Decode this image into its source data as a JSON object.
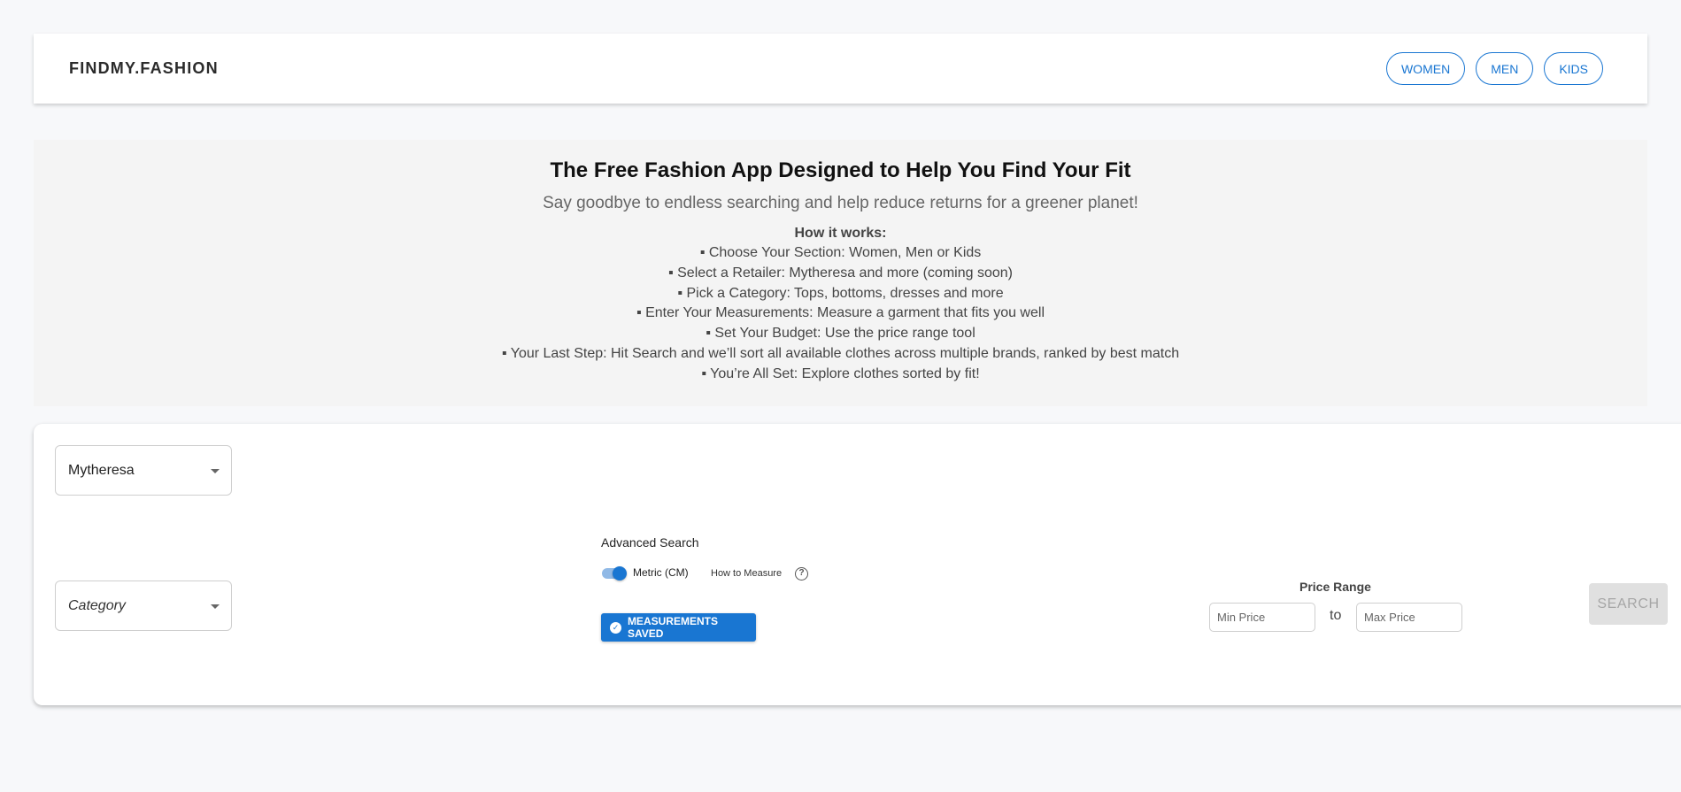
{
  "header": {
    "logo": "FINDMY.FASHION",
    "nav": [
      "WOMEN",
      "MEN",
      "KIDS"
    ]
  },
  "intro": {
    "title": "The Free Fashion App Designed to Help You Find Your Fit",
    "subtitle": "Say goodbye to endless searching and help reduce returns for a greener planet!",
    "how_title": "How it works:",
    "steps": [
      "▪ Choose Your Section: Women, Men or Kids",
      "▪ Select a Retailer: Mytheresa and more (coming soon)",
      "▪ Pick a Category: Tops, bottoms, dresses and more",
      "▪ Enter Your Measurements: Measure a garment that fits you well",
      "▪ Set Your Budget: Use the price range tool",
      "▪ Your Last Step: Hit Search and we’ll sort all available clothes across multiple brands, ranked by best match",
      "▪ You’re All Set: Explore clothes sorted by fit!"
    ]
  },
  "search": {
    "retailer": "Mytheresa",
    "category_placeholder": "Category",
    "advanced_title": "Advanced Search",
    "unit_label": "Metric (CM)",
    "unit_toggle_on": true,
    "how_to_measure": "How to Measure",
    "help_icon": "question-circle-icon",
    "saved_label": "MEASUREMENTS SAVED",
    "saved_icon": "check-circle-icon",
    "price_title": "Price Range",
    "min_placeholder": "Min Price",
    "to_label": "to",
    "max_placeholder": "Max Price",
    "search_label": "SEARCH"
  },
  "colors": {
    "accent": "#1976d2",
    "background": "#f7f8fa",
    "intro_bg": "#f4f4f4",
    "disabled_bg": "#e0e0e0"
  }
}
